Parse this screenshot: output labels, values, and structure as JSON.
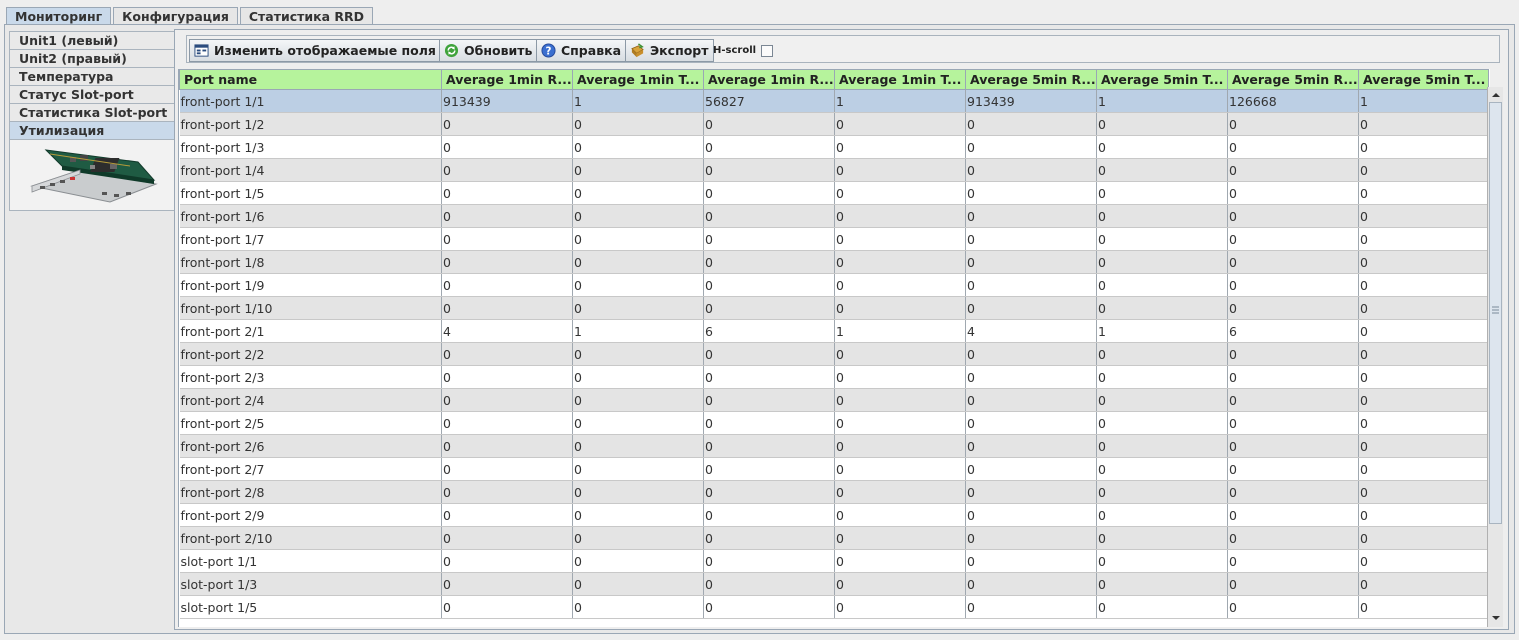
{
  "top_tabs": [
    {
      "label": "Мониторинг"
    },
    {
      "label": "Конфигурация"
    },
    {
      "label": "Статистика RRD"
    }
  ],
  "side_tabs": [
    {
      "label": "Unit1 (левый)"
    },
    {
      "label": "Unit2 (правый)"
    },
    {
      "label": "Температура"
    },
    {
      "label": "Статус Slot-port"
    },
    {
      "label": "Статистика Slot-port"
    },
    {
      "label": "Утилизация"
    }
  ],
  "toolbar": {
    "change_fields_label": "Изменить отображаемые поля",
    "refresh_label": "Обновить",
    "help_label": "Справка",
    "export_label": "Экспорт",
    "hscroll_label": "H-scroll",
    "hscroll_checked": false
  },
  "table": {
    "columns": [
      "Port name",
      "Average 1min R...",
      "Average 1min T...",
      "Average 1min R...",
      "Average 1min T...",
      "Average 5min R...",
      "Average 5min T...",
      "Average 5min R...",
      "Average 5min T..."
    ],
    "rows": [
      [
        "front-port 1/1",
        "913439",
        "1",
        "56827",
        "1",
        "913439",
        "1",
        "126668",
        "1"
      ],
      [
        "front-port 1/2",
        "0",
        "0",
        "0",
        "0",
        "0",
        "0",
        "0",
        "0"
      ],
      [
        "front-port 1/3",
        "0",
        "0",
        "0",
        "0",
        "0",
        "0",
        "0",
        "0"
      ],
      [
        "front-port 1/4",
        "0",
        "0",
        "0",
        "0",
        "0",
        "0",
        "0",
        "0"
      ],
      [
        "front-port 1/5",
        "0",
        "0",
        "0",
        "0",
        "0",
        "0",
        "0",
        "0"
      ],
      [
        "front-port 1/6",
        "0",
        "0",
        "0",
        "0",
        "0",
        "0",
        "0",
        "0"
      ],
      [
        "front-port 1/7",
        "0",
        "0",
        "0",
        "0",
        "0",
        "0",
        "0",
        "0"
      ],
      [
        "front-port 1/8",
        "0",
        "0",
        "0",
        "0",
        "0",
        "0",
        "0",
        "0"
      ],
      [
        "front-port 1/9",
        "0",
        "0",
        "0",
        "0",
        "0",
        "0",
        "0",
        "0"
      ],
      [
        "front-port 1/10",
        "0",
        "0",
        "0",
        "0",
        "0",
        "0",
        "0",
        "0"
      ],
      [
        "front-port 2/1",
        "4",
        "1",
        "6",
        "1",
        "4",
        "1",
        "6",
        "0"
      ],
      [
        "front-port 2/2",
        "0",
        "0",
        "0",
        "0",
        "0",
        "0",
        "0",
        "0"
      ],
      [
        "front-port 2/3",
        "0",
        "0",
        "0",
        "0",
        "0",
        "0",
        "0",
        "0"
      ],
      [
        "front-port 2/4",
        "0",
        "0",
        "0",
        "0",
        "0",
        "0",
        "0",
        "0"
      ],
      [
        "front-port 2/5",
        "0",
        "0",
        "0",
        "0",
        "0",
        "0",
        "0",
        "0"
      ],
      [
        "front-port 2/6",
        "0",
        "0",
        "0",
        "0",
        "0",
        "0",
        "0",
        "0"
      ],
      [
        "front-port 2/7",
        "0",
        "0",
        "0",
        "0",
        "0",
        "0",
        "0",
        "0"
      ],
      [
        "front-port 2/8",
        "0",
        "0",
        "0",
        "0",
        "0",
        "0",
        "0",
        "0"
      ],
      [
        "front-port 2/9",
        "0",
        "0",
        "0",
        "0",
        "0",
        "0",
        "0",
        "0"
      ],
      [
        "front-port 2/10",
        "0",
        "0",
        "0",
        "0",
        "0",
        "0",
        "0",
        "0"
      ],
      [
        "slot-port 1/1",
        "0",
        "0",
        "0",
        "0",
        "0",
        "0",
        "0",
        "0"
      ],
      [
        "slot-port 1/3",
        "0",
        "0",
        "0",
        "0",
        "0",
        "0",
        "0",
        "0"
      ],
      [
        "slot-port 1/5",
        "0",
        "0",
        "0",
        "0",
        "0",
        "0",
        "0",
        "0"
      ]
    ],
    "selected_row": 0
  },
  "colors": {
    "header_bg": "#b6f39c",
    "selected_row": "#bccfe4",
    "active_tab": "#c9d9ea"
  },
  "icons": [
    "fields-icon",
    "refresh-icon",
    "help-icon",
    "export-icon"
  ]
}
